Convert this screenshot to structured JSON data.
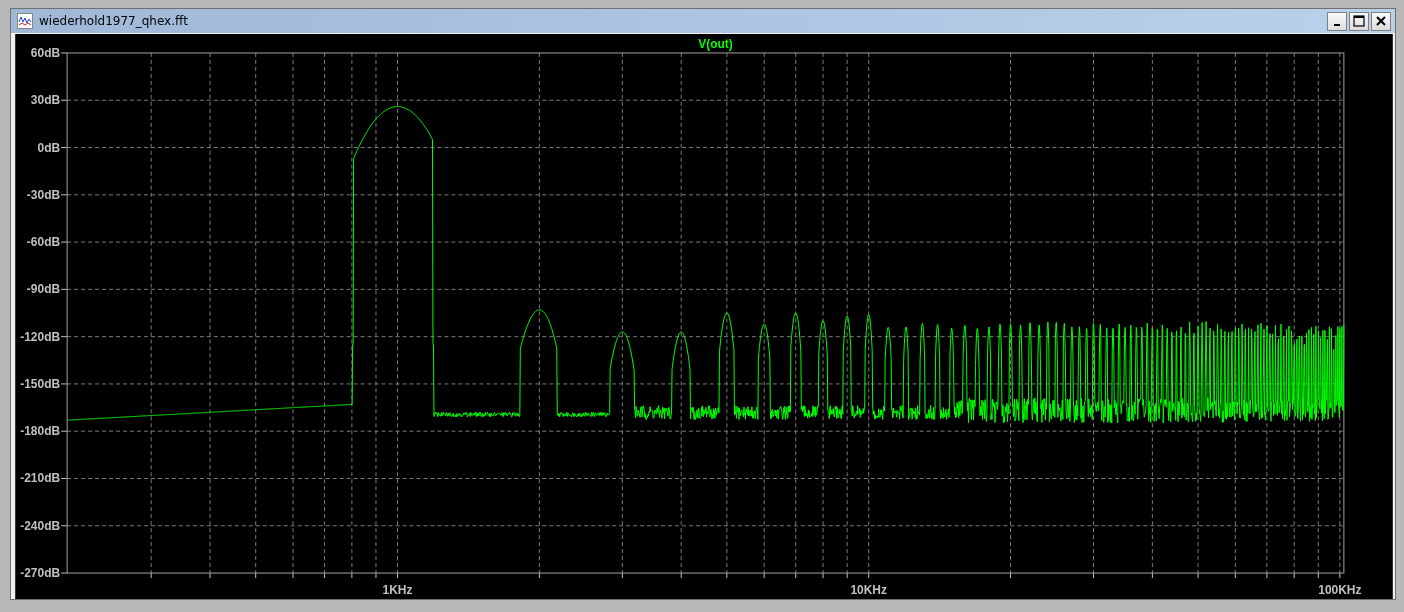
{
  "window": {
    "title": "wiederhold1977_qhex.fft"
  },
  "plot": {
    "trace_label": "V(out)",
    "y_axis_labels": [
      "60dB",
      "30dB",
      "0dB",
      "-30dB",
      "-60dB",
      "-90dB",
      "-120dB",
      "-150dB",
      "-180dB",
      "-210dB",
      "-240dB",
      "-270dB"
    ],
    "x_axis_labels": [
      "1KHz",
      "10KHz",
      "100KHz"
    ]
  }
}
